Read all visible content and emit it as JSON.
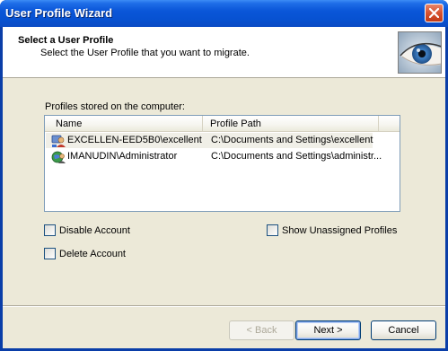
{
  "window": {
    "title": "User Profile Wizard"
  },
  "header": {
    "title": "Select a User Profile",
    "subtitle": "Select the User Profile that you want to migrate."
  },
  "profiles": {
    "label": "Profiles stored on the computer:",
    "columns": [
      "Name",
      "Profile Path"
    ],
    "rows": [
      {
        "name": "EXCELLEN-EED5B0\\excellent",
        "path": "C:\\Documents and Settings\\excellent",
        "icon": "user-profile-icon"
      },
      {
        "name": "IMANUDIN\\Administrator",
        "path": "C:\\Documents and Settings\\administr...",
        "icon": "globe-user-icon"
      }
    ]
  },
  "options": {
    "disable_account": "Disable Account",
    "delete_account": "Delete Account",
    "show_unassigned": "Show Unassigned Profiles"
  },
  "buttons": {
    "back": "< Back",
    "next": "Next >",
    "cancel": "Cancel"
  },
  "colors": {
    "titlebar": "#0752d2",
    "dialog_bg": "#ece9d8",
    "close_button": "#d6522f"
  }
}
